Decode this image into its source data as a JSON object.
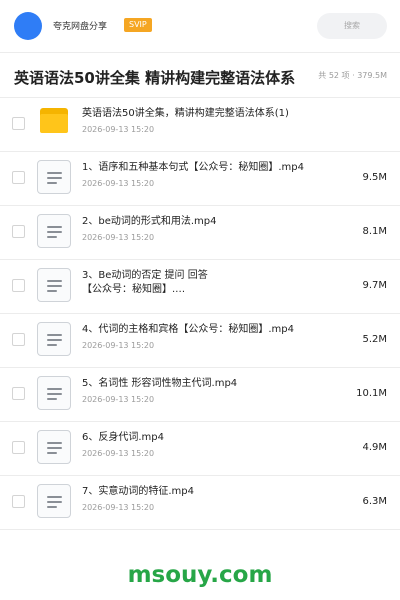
{
  "header": {
    "user_name": "夸克网盘分享",
    "vip_badge": "SVIP",
    "search_placeholder": "搜索"
  },
  "folder": {
    "title": "英语语法50讲全集 精讲构建完整语法体系",
    "summary": "共 52 项 · 379.5M"
  },
  "files": [
    {
      "name": "英语语法50讲全集，精讲构建完整语法体系(1)",
      "date": "2026-09-13 15:20",
      "size": "",
      "type": "folder-icon"
    },
    {
      "name": "1、语序和五种基本句式【公众号：秘知圈】.mp4",
      "date": "2026-09-13 15:20",
      "size": "9.5M",
      "type": "video-file-icon"
    },
    {
      "name": "2、be动词的形式和用法.mp4",
      "date": "2026-09-13 15:20",
      "size": "8.1M",
      "type": "video-file-icon"
    },
    {
      "name": "3、Be动词的否定 提问 回答【公众号：秘知圈】.…",
      "date": "",
      "size": "9.7M",
      "type": "video-file-icon"
    },
    {
      "name": "4、代词的主格和宾格【公众号：秘知圈】.mp4",
      "date": "2026-09-13 15:20",
      "size": "5.2M",
      "type": "video-file-icon"
    },
    {
      "name": "5、名词性 形容词性物主代词.mp4",
      "date": "2026-09-13 15:20",
      "size": "10.1M",
      "type": "video-file-icon"
    },
    {
      "name": "6、反身代词.mp4",
      "date": "2026-09-13 15:20",
      "size": "4.9M",
      "type": "video-file-icon"
    },
    {
      "name": "7、实意动词的特征.mp4",
      "date": "2026-09-13 15:20",
      "size": "6.3M",
      "type": "video-file-icon"
    }
  ],
  "brand": "msouy.com"
}
